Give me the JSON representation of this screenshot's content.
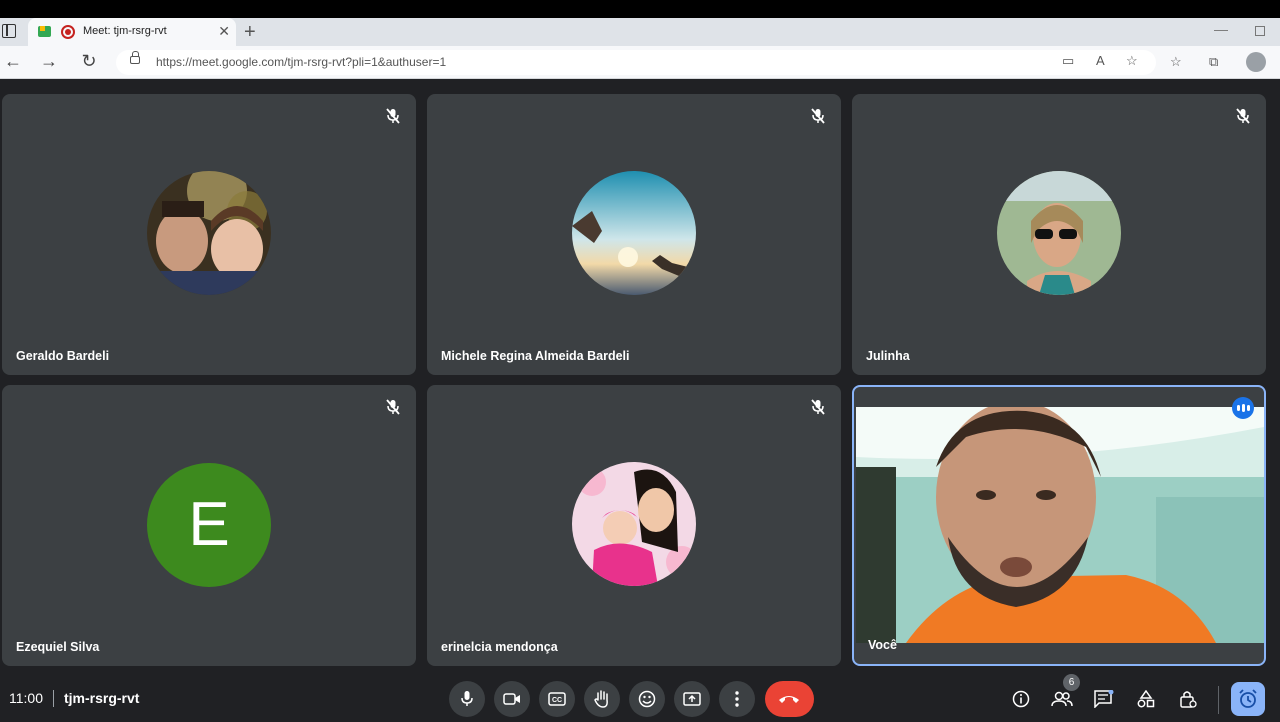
{
  "browser": {
    "tab_title": "Meet: tjm-rsrg-rvt",
    "url": "https://meet.google.com/tjm-rsrg-rvt?pli=1&authuser=1"
  },
  "participants": [
    {
      "name": "Geraldo Bardeli",
      "muted": true,
      "avatar": "photo"
    },
    {
      "name": "Michele Regina Almeida Bardeli",
      "muted": true,
      "avatar": "photo"
    },
    {
      "name": "Julinha",
      "muted": true,
      "avatar": "photo"
    },
    {
      "name": "Ezequiel Silva",
      "muted": true,
      "avatar": "letter",
      "letter": "E",
      "color": "#3d8a1e"
    },
    {
      "name": "erinelcia mendonça",
      "muted": true,
      "avatar": "photo"
    },
    {
      "name": "Você",
      "muted": false,
      "avatar": "video",
      "speaking": true
    }
  ],
  "meeting": {
    "time": "11:00",
    "code": "tjm-rsrg-rvt",
    "people_count": "6"
  },
  "colors": {
    "hangup": "#ea4335",
    "accent": "#8ab4f8",
    "tile_bg": "#3c4043"
  }
}
